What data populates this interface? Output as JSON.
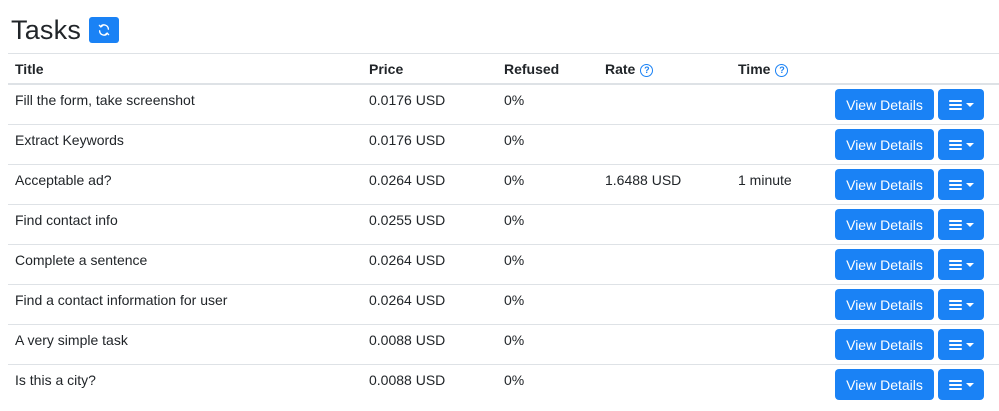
{
  "header": {
    "title": "Tasks",
    "refresh_icon": "refresh-icon"
  },
  "table": {
    "columns": {
      "title": "Title",
      "price": "Price",
      "refused": "Refused",
      "rate": "Rate",
      "time": "Time"
    },
    "help_icon": "question-circle-icon",
    "rows": [
      {
        "title": "Fill the form, take screenshot",
        "price": "0.0176 USD",
        "refused": "0%",
        "rate": "",
        "time": ""
      },
      {
        "title": "Extract Keywords",
        "price": "0.0176 USD",
        "refused": "0%",
        "rate": "",
        "time": ""
      },
      {
        "title": "Acceptable ad?",
        "price": "0.0264 USD",
        "refused": "0%",
        "rate": "1.6488 USD",
        "time": "1 minute"
      },
      {
        "title": "Find contact info",
        "price": "0.0255 USD",
        "refused": "0%",
        "rate": "",
        "time": ""
      },
      {
        "title": "Complete a sentence",
        "price": "0.0264 USD",
        "refused": "0%",
        "rate": "",
        "time": ""
      },
      {
        "title": "Find a contact information for user",
        "price": "0.0264 USD",
        "refused": "0%",
        "rate": "",
        "time": ""
      },
      {
        "title": "A very simple task",
        "price": "0.0088 USD",
        "refused": "0%",
        "rate": "",
        "time": ""
      },
      {
        "title": "Is this a city?",
        "price": "0.0088 USD",
        "refused": "0%",
        "rate": "",
        "time": ""
      }
    ],
    "view_details_label": "View Details",
    "menu_icon": "hamburger-menu-icon"
  },
  "colors": {
    "accent": "#1a82f5",
    "border": "#dee2e6",
    "text": "#212529"
  }
}
